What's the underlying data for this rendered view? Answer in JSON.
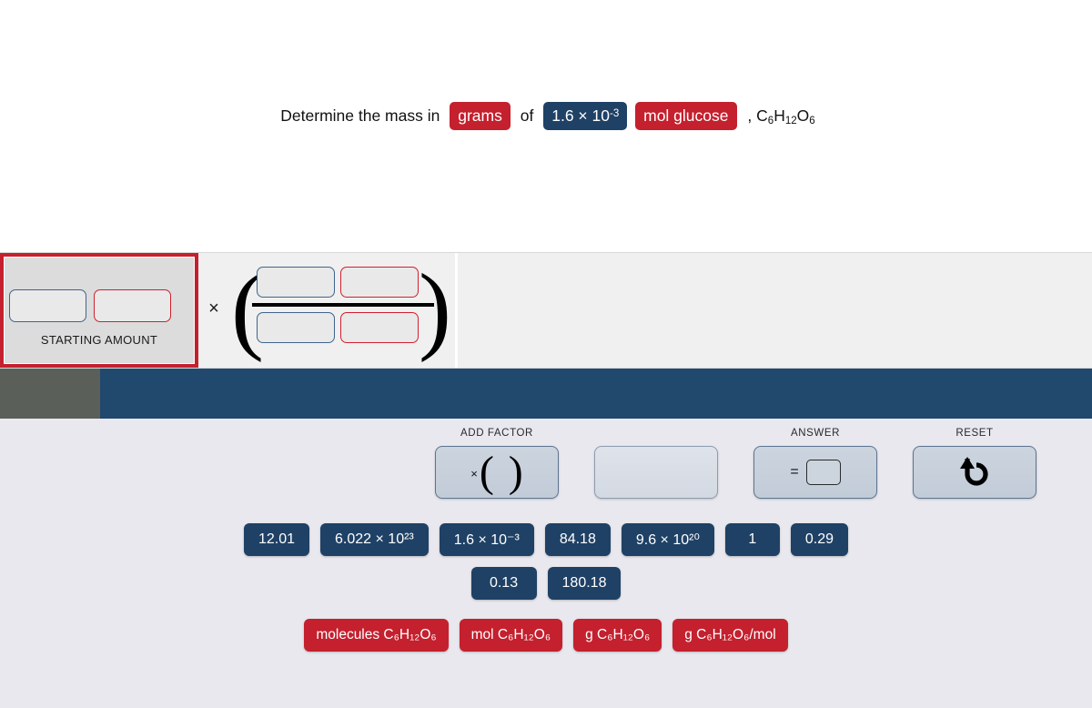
{
  "problem": {
    "lead_text": "Determine the mass in",
    "unit_chip": "grams",
    "connector": "of",
    "quantity_chip_mantissa": "1.6 × 10",
    "quantity_chip_exponent": "-3",
    "substance_chip": "mol glucose",
    "formula_comma": ", C",
    "formula_sub1": "6",
    "formula_H": "H",
    "formula_sub2": "12",
    "formula_O": "O",
    "formula_sub3": "6"
  },
  "workspace": {
    "starting_amount_label": "STARTING AMOUNT",
    "times_symbol": "×",
    "starting_value_slot": "",
    "starting_unit_slot": "",
    "numerator_value_slot": "",
    "numerator_unit_slot": "",
    "denominator_value_slot": "",
    "denominator_unit_slot": ""
  },
  "toolbar": {
    "add_factor_label": "ADD FACTOR",
    "add_factor_x": "×",
    "add_factor_paren_open": "(",
    "add_factor_paren_close": ")",
    "blank_label": "",
    "answer_label": "ANSWER",
    "answer_equals": "=",
    "answer_value": "",
    "reset_label": "RESET",
    "reset_icon": "undo-arrow-icon"
  },
  "tiles": {
    "row1": [
      "12.01",
      "6.022 × 10²³",
      "1.6 × 10⁻³",
      "84.18",
      "9.6 × 10²⁰",
      "1",
      "0.29"
    ],
    "row2": [
      "0.13",
      "180.18"
    ],
    "units": [
      "molecules C₆H₁₂O₆",
      "mol C₆H₁₂O₆",
      "g C₆H₁₂O₆",
      "g C₆H₁₂O₆/mol"
    ]
  },
  "colors": {
    "red": "#c4202e",
    "navy": "#1f4165",
    "band_navy": "#21486d",
    "band_gray": "#5a6059",
    "tray_bg": "#e8e8ee",
    "work_bg": "#f0f0f0"
  }
}
